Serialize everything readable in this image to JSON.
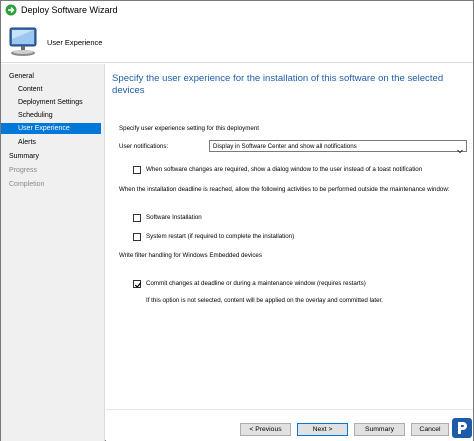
{
  "window": {
    "title": "Deploy Software Wizard"
  },
  "header": {
    "page_name": "User Experience"
  },
  "nav": {
    "items": [
      {
        "label": "General",
        "level": "top",
        "state": "normal"
      },
      {
        "label": "Content",
        "level": "sub",
        "state": "normal"
      },
      {
        "label": "Deployment Settings",
        "level": "sub",
        "state": "normal"
      },
      {
        "label": "Scheduling",
        "level": "sub",
        "state": "normal"
      },
      {
        "label": "User Experience",
        "level": "sub",
        "state": "selected"
      },
      {
        "label": "Alerts",
        "level": "sub",
        "state": "normal"
      },
      {
        "label": "Summary",
        "level": "top",
        "state": "normal"
      },
      {
        "label": "Progress",
        "level": "top",
        "state": "disabled"
      },
      {
        "label": "Completion",
        "level": "top",
        "state": "disabled"
      }
    ]
  },
  "main": {
    "heading": "Specify the user experience for the installation of this software on the selected devices",
    "section_label": "Specify user experience setting for this deployment",
    "notifications_label": "User notifications:",
    "notifications_value": "Display in Software Center and show all notifications",
    "dialog_checkbox": {
      "label": "When software changes are required, show a dialog window to the user instead of a toast notification",
      "checked": false
    },
    "deadline_label": "When the installation deadline is reached, allow the following activities to be performed outside the maintenance window:",
    "software_install_checkbox": {
      "label": "Software Installation",
      "checked": false
    },
    "system_restart_checkbox": {
      "label": "System restart  (if required to complete the installation)",
      "checked": false
    },
    "write_filter_label": "Write filter handling for Windows Embedded devices",
    "commit_checkbox": {
      "label": "Commit changes at deadline or during a maintenance window (requires restarts)",
      "checked": true
    },
    "commit_note": "If this option is not selected, content will be applied on the overlay and committed later."
  },
  "footer": {
    "previous_label": "< Previous",
    "next_label": "Next >",
    "summary_label": "Summary",
    "cancel_label": "Cancel"
  },
  "colors": {
    "accent": "#0078d7",
    "heading": "#1f5fa8",
    "nav_bg": "#f0f0f0"
  },
  "icons": {
    "title": "green-arrow-icon",
    "header": "computer-icon",
    "select": "chevron-down-icon",
    "watermark": "logo-icon"
  }
}
